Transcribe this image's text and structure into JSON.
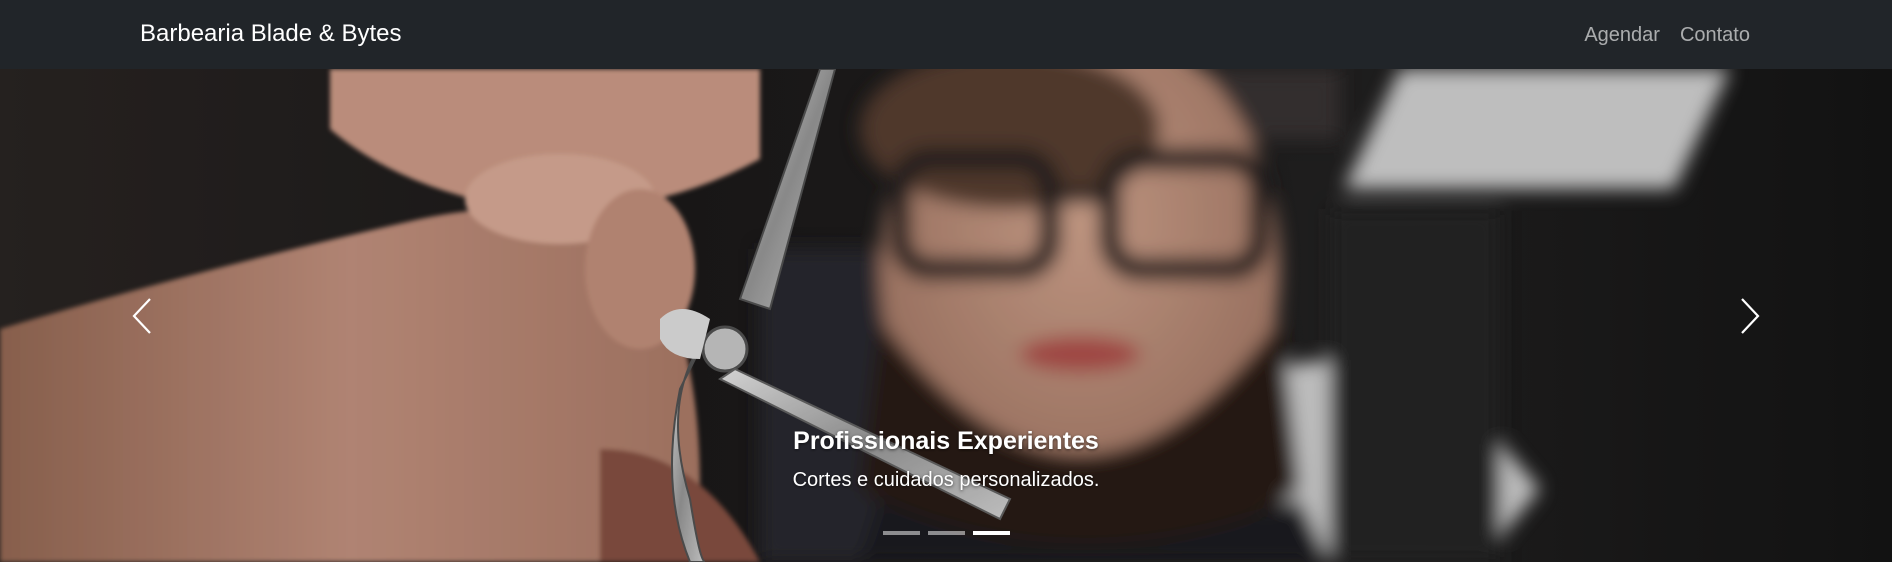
{
  "navbar": {
    "brand": "Barbearia Blade & Bytes",
    "links": [
      {
        "label": "Agendar"
      },
      {
        "label": "Contato"
      }
    ]
  },
  "carousel": {
    "caption": {
      "title": "Profissionais Experientes",
      "text": "Cortes e cuidados personalizados."
    },
    "controls": {
      "prev_icon": "chevron-left-icon",
      "next_icon": "chevron-right-icon"
    },
    "slide_count": 3,
    "active_index": 2
  },
  "colors": {
    "navbar_bg": "#212529",
    "brand_text": "#ffffff",
    "nav_link_text": "#a6a7a9"
  }
}
